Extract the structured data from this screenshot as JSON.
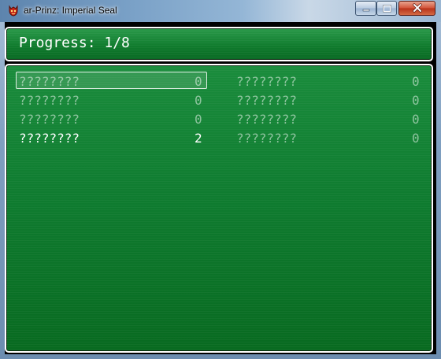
{
  "window": {
    "title": "ar-Prinz: Imperial Seal",
    "app_icon": "red-demon-icon",
    "controls": {
      "minimize": "minimize-icon",
      "maximize": "maximize-icon",
      "close": "close-icon"
    }
  },
  "progress": {
    "label": "Progress: 1/8",
    "found": 1,
    "total": 8
  },
  "items": [
    {
      "name": "????????",
      "count": "0",
      "state": "dim",
      "selected": true
    },
    {
      "name": "????????",
      "count": "0",
      "state": "dim",
      "selected": false
    },
    {
      "name": "????????",
      "count": "0",
      "state": "dim",
      "selected": false
    },
    {
      "name": "????????",
      "count": "0",
      "state": "dim",
      "selected": false
    },
    {
      "name": "????????",
      "count": "0",
      "state": "dim",
      "selected": false
    },
    {
      "name": "????????",
      "count": "0",
      "state": "dim",
      "selected": false
    },
    {
      "name": "????????",
      "count": "2",
      "state": "bright",
      "selected": false
    },
    {
      "name": "????????",
      "count": "0",
      "state": "dim",
      "selected": false
    }
  ],
  "colors": {
    "window_bg": "#0f7c30",
    "window_border": "#ffffff",
    "text": "#ffffff"
  }
}
